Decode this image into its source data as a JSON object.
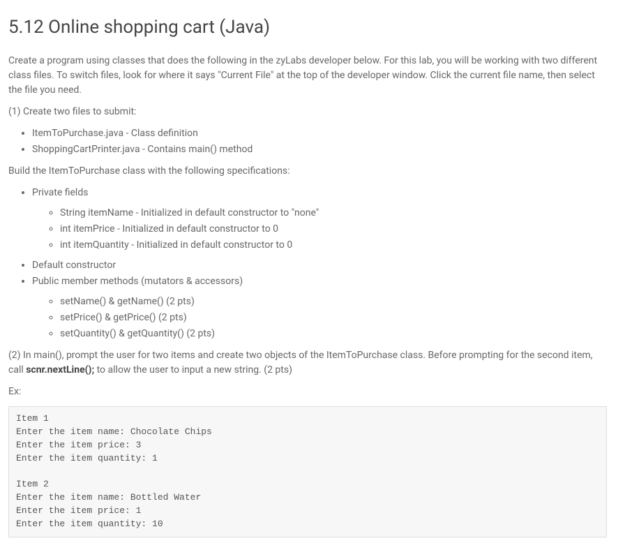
{
  "title": "5.12 Online shopping cart (Java)",
  "intro": "Create a program using classes that does the following in the zyLabs developer below. For this lab, you will be working with two different class files. To switch files, look for where it says \"Current File\" at the top of the developer window. Click the current file name, then select the file you need.",
  "step1_heading": "(1) Create two files to submit:",
  "files": [
    "ItemToPurchase.java - Class definition",
    "ShoppingCartPrinter.java - Contains main() method"
  ],
  "build_text": "Build the ItemToPurchase class with the following specifications:",
  "spec": {
    "private_fields_label": "Private fields",
    "private_fields": [
      "String itemName - Initialized in default constructor to \"none\"",
      "int itemPrice - Initialized in default constructor to 0",
      "int itemQuantity - Initialized in default constructor to 0"
    ],
    "default_constructor": "Default constructor",
    "public_methods_label": "Public member methods (mutators & accessors)",
    "public_methods": [
      "setName() & getName() (2 pts)",
      "setPrice() & getPrice() (2 pts)",
      "setQuantity() & getQuantity() (2 pts)"
    ]
  },
  "step2_prefix": "(2) In main(), prompt the user for two items and create two objects of the ItemToPurchase class. Before prompting for the second item, call ",
  "step2_bold": "scnr.nextLine();",
  "step2_suffix": " to allow the user to input a new string. (2 pts)",
  "ex_label": "Ex:",
  "example_output": "Item 1\nEnter the item name: Chocolate Chips\nEnter the item price: 3\nEnter the item quantity: 1\n\nItem 2\nEnter the item name: Bottled Water\nEnter the item price: 1\nEnter the item quantity: 10"
}
